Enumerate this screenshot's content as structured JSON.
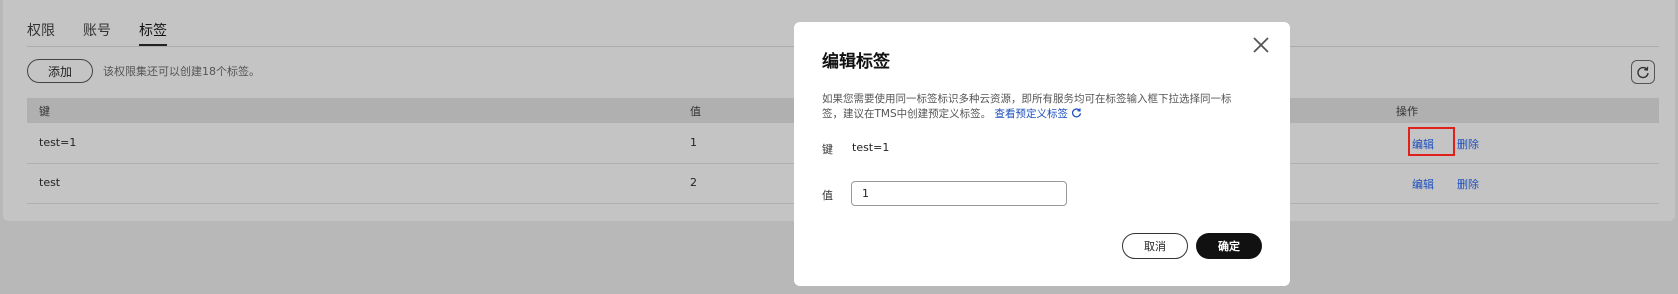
{
  "tabs": [
    {
      "label": "权限"
    },
    {
      "label": "账号"
    },
    {
      "label": "标签"
    }
  ],
  "toolbar": {
    "add_label": "添加",
    "quota_text": "该权限集还可以创建18个标签。"
  },
  "table": {
    "headers": {
      "key": "键",
      "value": "值",
      "actions": "操作"
    },
    "rows": [
      {
        "key": "test=1",
        "value": "1",
        "edit": "编辑",
        "delete": "删除"
      },
      {
        "key": "test",
        "value": "2",
        "edit": "编辑",
        "delete": "删除"
      }
    ]
  },
  "modal": {
    "title": "编辑标签",
    "description": "如果您需要使用同一标签标识多种云资源，即所有服务均可在标签输入框下拉选择同一标签，建议在TMS中创建预定义标签。",
    "link_text": "查看预定义标签",
    "key_label": "键",
    "key_value": "test=1",
    "value_label": "值",
    "value_input": "1",
    "cancel_label": "取消",
    "ok_label": "确定"
  },
  "colors": {
    "link": "#1d4fbf",
    "highlight": "#e0201a",
    "primary_button": "#111111"
  },
  "icons": [
    "refresh-icon",
    "close-icon",
    "link-refresh-icon"
  ]
}
